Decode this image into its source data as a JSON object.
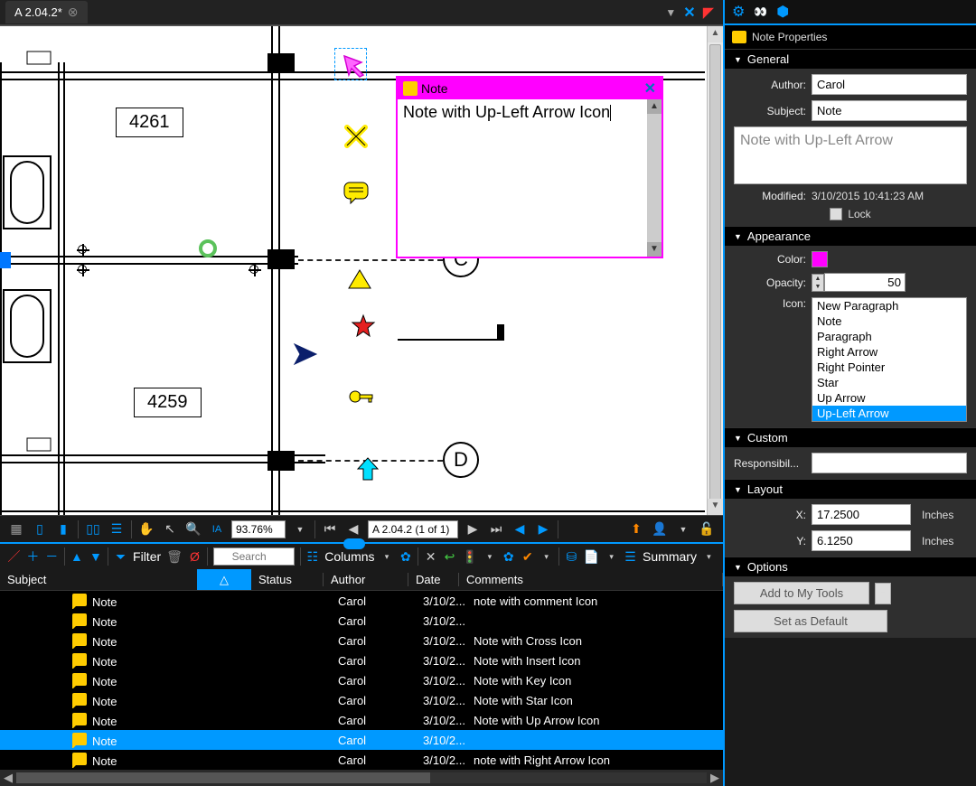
{
  "tab": {
    "title": "A 2.04.2*"
  },
  "canvas": {
    "room_labels": [
      "4261",
      "4259"
    ],
    "grid_labels": [
      "C",
      "D"
    ],
    "zoom": "93.76%",
    "page": "A 2.04.2 (1 of 1)",
    "note_popup": {
      "title": "Note",
      "text": "Note with Up-Left Arrow Icon"
    }
  },
  "markups_toolbar": {
    "filter_label": "Filter",
    "search_placeholder": "Search",
    "columns_label": "Columns",
    "summary_label": "Summary"
  },
  "markups_table": {
    "headers": [
      "Subject",
      "Status",
      "Author",
      "Date",
      "Comments"
    ],
    "rows": [
      {
        "subject": "Note",
        "author": "Carol",
        "date": "3/10/2...",
        "comments": "note with comment Icon",
        "selected": false
      },
      {
        "subject": "Note",
        "author": "Carol",
        "date": "3/10/2...",
        "comments": "",
        "selected": false
      },
      {
        "subject": "Note",
        "author": "Carol",
        "date": "3/10/2...",
        "comments": "Note with Cross Icon",
        "selected": false
      },
      {
        "subject": "Note",
        "author": "Carol",
        "date": "3/10/2...",
        "comments": "Note with Insert Icon",
        "selected": false
      },
      {
        "subject": "Note",
        "author": "Carol",
        "date": "3/10/2...",
        "comments": "Note with Key Icon",
        "selected": false
      },
      {
        "subject": "Note",
        "author": "Carol",
        "date": "3/10/2...",
        "comments": "Note with Star Icon",
        "selected": false
      },
      {
        "subject": "Note",
        "author": "Carol",
        "date": "3/10/2...",
        "comments": "Note with Up Arrow Icon",
        "selected": false
      },
      {
        "subject": "Note",
        "author": "Carol",
        "date": "3/10/2...",
        "comments": "",
        "selected": true
      },
      {
        "subject": "Note",
        "author": "Carol",
        "date": "3/10/2...",
        "comments": "note with Right Arrow Icon",
        "selected": false
      }
    ]
  },
  "properties": {
    "panel_title": "Note Properties",
    "sections": {
      "general": "General",
      "appearance": "Appearance",
      "custom": "Custom",
      "layout": "Layout",
      "options": "Options"
    },
    "author_label": "Author:",
    "author": "Carol",
    "subject_label": "Subject:",
    "subject": "Note",
    "description": "Note with Up-Left Arrow",
    "modified_label": "Modified:",
    "modified": "3/10/2015 10:41:23 AM",
    "lock_label": "Lock",
    "color_label": "Color:",
    "color": "#ff00ff",
    "opacity_label": "Opacity:",
    "opacity": "50",
    "icon_label": "Icon:",
    "icon_options": [
      "New Paragraph",
      "Note",
      "Paragraph",
      "Right Arrow",
      "Right Pointer",
      "Star",
      "Up Arrow",
      "Up-Left Arrow"
    ],
    "icon_selected": "Up-Left Arrow",
    "responsibility_label": "Responsibil...",
    "x_label": "X:",
    "x": "17.2500",
    "y_label": "Y:",
    "y": "6.1250",
    "unit": "Inches",
    "add_tools": "Add to My Tools",
    "set_default": "Set as Default"
  }
}
